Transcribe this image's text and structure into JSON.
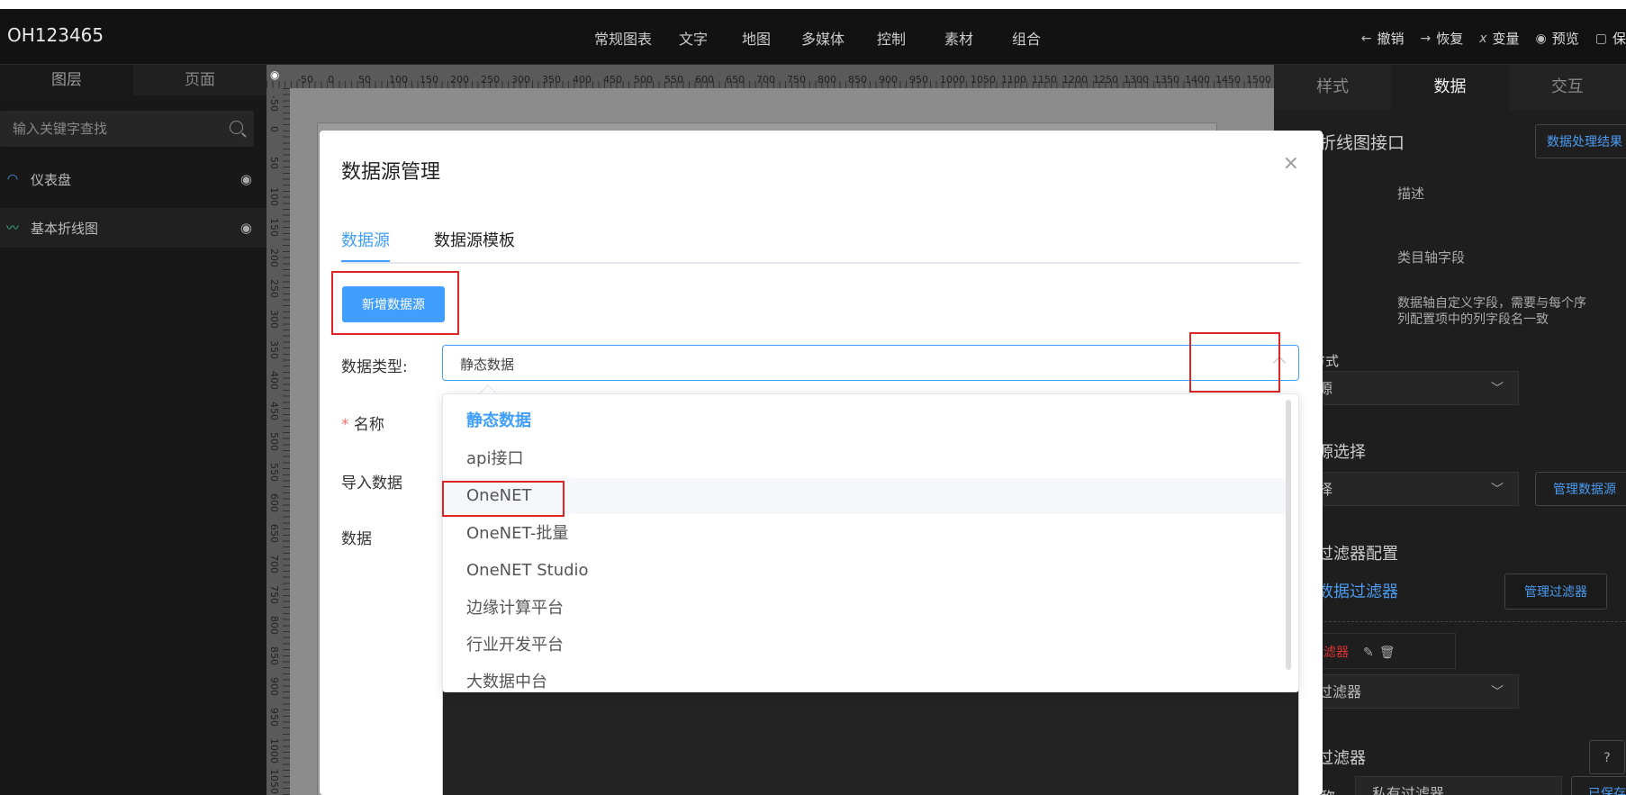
{
  "header": {
    "app_title": "OH123465",
    "menu": [
      "常规图表",
      "文字",
      "地图",
      "多媒体",
      "控制",
      "素材",
      "组合"
    ],
    "actions": [
      {
        "icon": "arrow-left-icon",
        "glyph": "←",
        "label": "撤销"
      },
      {
        "icon": "arrow-right-icon",
        "glyph": "→",
        "label": "恢复"
      },
      {
        "icon": "variable-icon",
        "glyph": "x",
        "label": "变量"
      },
      {
        "icon": "eye-icon",
        "glyph": "◉",
        "label": "预览"
      },
      {
        "icon": "save-icon",
        "glyph": "▢",
        "label": "保"
      }
    ]
  },
  "left_panel": {
    "tabs": [
      "图层",
      "页面"
    ],
    "search_placeholder": "输入关键字查找",
    "layers": [
      {
        "icon": "gauge-icon",
        "glyph": "◠",
        "name": "仪表盘"
      },
      {
        "icon": "line-chart-icon",
        "glyph": "〰",
        "name": "基本折线图"
      }
    ]
  },
  "ruler": {
    "top_ticks": [
      "-50",
      "0",
      "50",
      "100",
      "150",
      "200",
      "250",
      "300",
      "350",
      "400",
      "450",
      "500",
      "550",
      "600",
      "650",
      "700",
      "750",
      "800",
      "850",
      "900",
      "950",
      "1000",
      "1050",
      "1100",
      "1150",
      "1200",
      "1250",
      "1300",
      "1350",
      "1400",
      "1450",
      "1500"
    ],
    "left_ticks": [
      "-50",
      "0",
      "50",
      "100",
      "150",
      "200",
      "250",
      "300",
      "350",
      "400",
      "450",
      "500",
      "550",
      "600",
      "650",
      "700",
      "750",
      "800",
      "850",
      "900",
      "950",
      "1000",
      "1050"
    ]
  },
  "right_panel": {
    "tabs": [
      "样式",
      "数据",
      "交互"
    ],
    "interface_title": "基本折线图接口",
    "data_result_btn": "数据处理结果",
    "desc_header": "描述",
    "category_field": "类目轴字段",
    "value_field_desc": "数据轴自定义字段，需要与每个序列配置项中的列字段名一致",
    "binding_method_label": "绑定方式",
    "binding_method_value": "数据源",
    "source_select_label": "数据源选择",
    "source_select_value": "请选择",
    "manage_source_btn": "管理数据源",
    "filter_config_label": "数据过滤器配置",
    "use_filter_link": "使用数据过滤器",
    "manage_filter_btn": "管理过滤器",
    "private_filter": "私有过滤器",
    "add_filter_label": "添加过滤器",
    "data_filter_label": "数据过滤器",
    "help": "?",
    "bottom_name_label": "名称",
    "bottom_name_value": "私有过滤器",
    "saved_btn": "已保存"
  },
  "modal": {
    "title": "数据源管理",
    "close": "×",
    "tabs": [
      "数据源",
      "数据源模板"
    ],
    "add_button": "新增数据源",
    "type_label": "数据类型:",
    "type_value": "静态数据",
    "name_label": "名称",
    "name_required": "*",
    "import_label": "导入数据",
    "data_label": "数据",
    "dropdown_options": [
      "静态数据",
      "api接口",
      "OneNET",
      "OneNET-批量",
      "OneNET Studio",
      "边缘计算平台",
      "行业开发平台",
      "大数据中台"
    ],
    "selected_option_index": 0,
    "hovered_option_index": 2
  },
  "colors": {
    "accent": "#409eff",
    "highlight_box": "#e02424",
    "header_bg": "#121212",
    "panel_bg": "#1e1e1e"
  }
}
